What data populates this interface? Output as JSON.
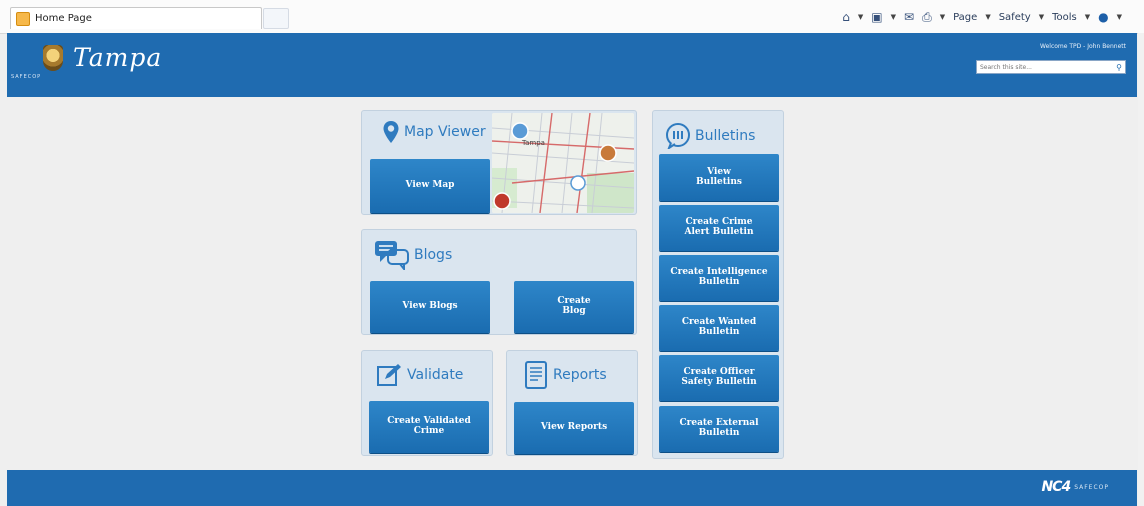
{
  "browser": {
    "tab_title": "Home Page",
    "commands": {
      "page": "Page",
      "safety": "Safety",
      "tools": "Tools"
    }
  },
  "header": {
    "logo_text": "Tampa",
    "logo_subtext": "SAFECOP",
    "welcome": "Welcome TPD - John Bennett",
    "search_placeholder": "Search this site..."
  },
  "map_viewer": {
    "title": "Map Viewer",
    "map_label": "Tampa",
    "button": "View Map"
  },
  "blogs": {
    "title": "Blogs",
    "view_button": "View Blogs",
    "create_button_line1": "Create",
    "create_button_line2": "Blog"
  },
  "validate": {
    "title": "Validate",
    "button_line1": "Create Validated",
    "button_line2": "Crime"
  },
  "reports": {
    "title": "Reports",
    "button": "View Reports"
  },
  "bulletins": {
    "title": "Bulletins",
    "buttons": [
      {
        "line1": "View",
        "line2": "Bulletins"
      },
      {
        "line1": "Create Crime",
        "line2": "Alert Bulletin"
      },
      {
        "line1": "Create Intelligence",
        "line2": "Bulletin"
      },
      {
        "line1": "Create Wanted",
        "line2": "Bulletin"
      },
      {
        "line1": "Create Officer",
        "line2": "Safety Bulletin"
      },
      {
        "line1": "Create External",
        "line2": "Bulletin"
      }
    ]
  },
  "footer": {
    "brand": "NC4",
    "brand_sub": "SAFECOP"
  },
  "colors": {
    "brand_blue": "#1f6bb0",
    "panel_bg": "#dae5ef",
    "title_blue": "#2f7bbf"
  }
}
